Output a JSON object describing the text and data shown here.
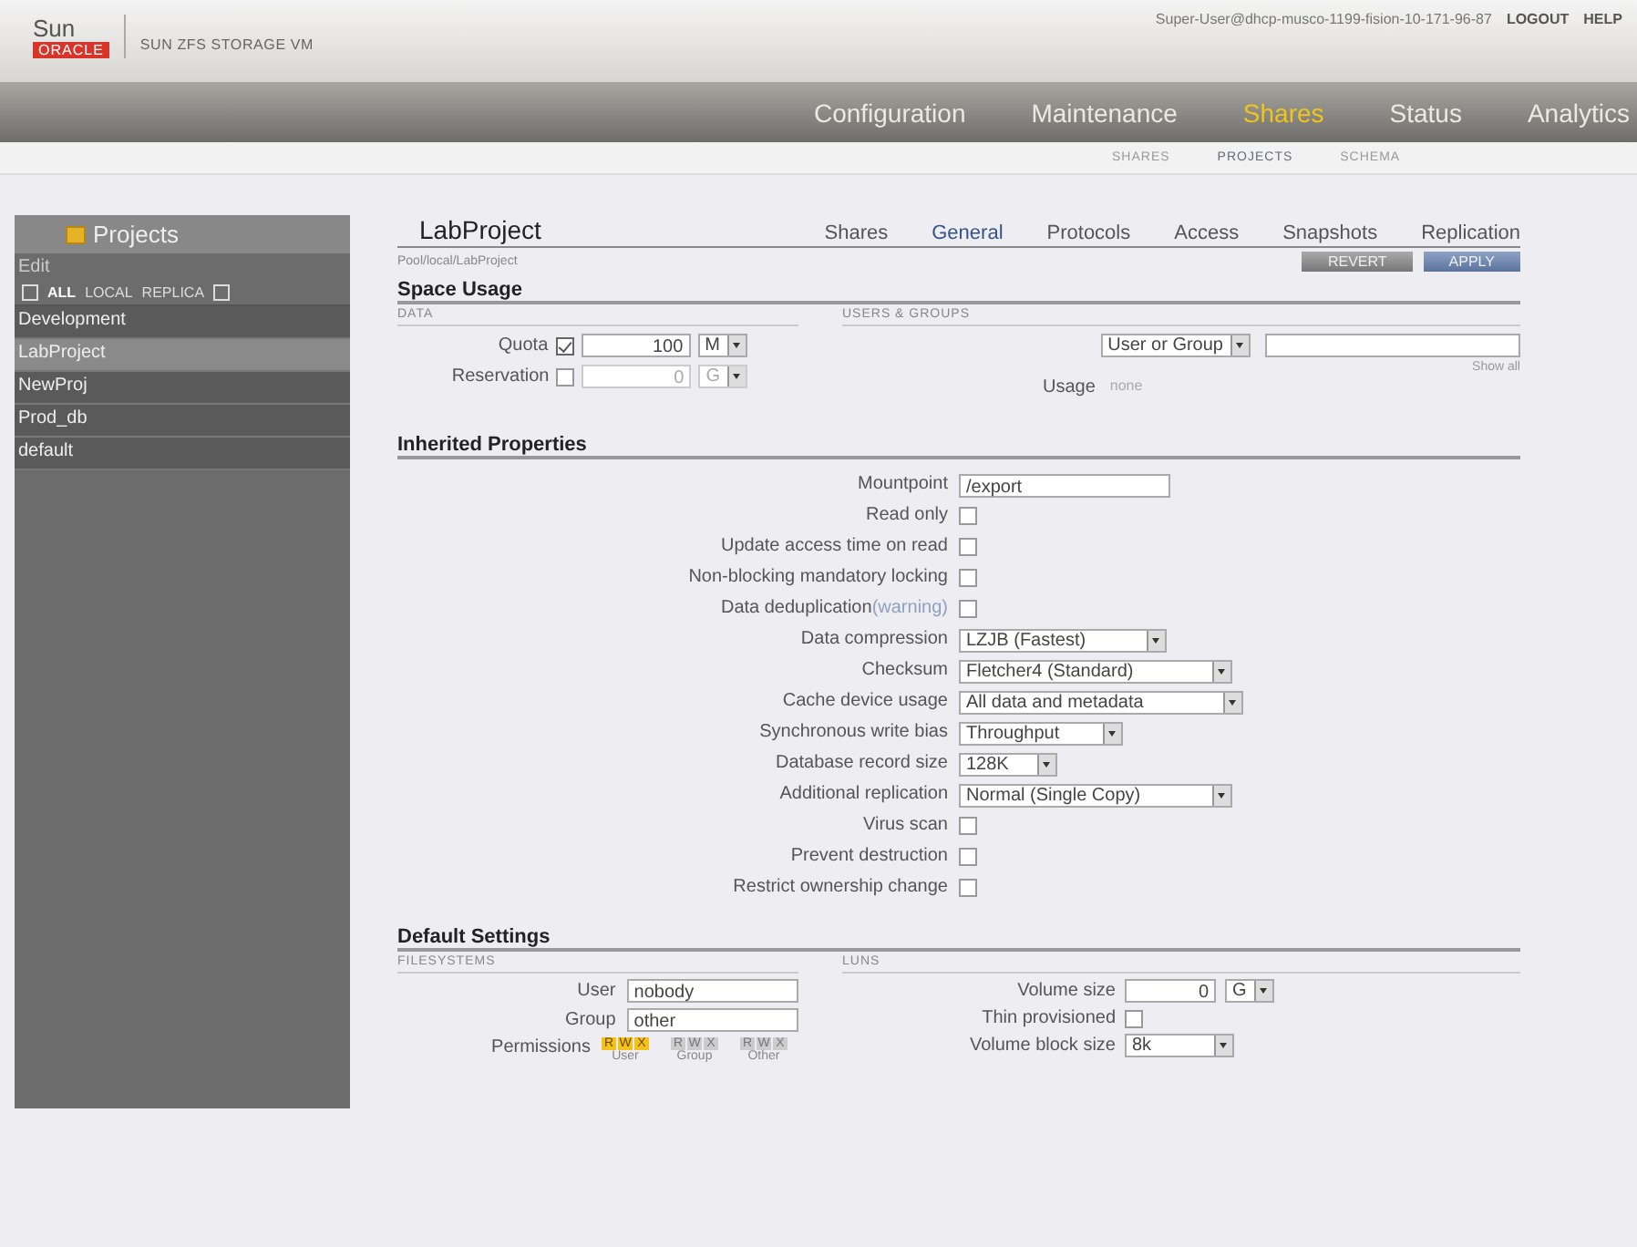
{
  "header": {
    "brand_top": "Sun",
    "brand_bottom": "ORACLE",
    "product": "SUN ZFS STORAGE VM",
    "user": "Super-User@dhcp-musco-1199-fision-10-171-96-87",
    "links": [
      "LOGOUT",
      "HELP"
    ]
  },
  "nav": {
    "tabs": [
      {
        "label": "Configuration",
        "selected": false
      },
      {
        "label": "Maintenance",
        "selected": false
      },
      {
        "label": "Shares",
        "selected": true
      },
      {
        "label": "Status",
        "selected": false
      },
      {
        "label": "Analytics",
        "selected": false
      }
    ],
    "subtabs": [
      {
        "label": "SHARES",
        "selected": false
      },
      {
        "label": "PROJECTS",
        "selected": true
      },
      {
        "label": "SCHEMA",
        "selected": false
      }
    ]
  },
  "sidebar": {
    "title": "Projects",
    "action": "Edit",
    "filters": [
      {
        "label": "ALL",
        "selected": true
      },
      {
        "label": "LOCAL",
        "selected": false
      },
      {
        "label": "REPLICA",
        "selected": false
      }
    ],
    "items": [
      {
        "label": "Development",
        "selected": false
      },
      {
        "label": "LabProject",
        "selected": true
      },
      {
        "label": "NewProj",
        "selected": false
      },
      {
        "label": "Prod_db",
        "selected": false
      },
      {
        "label": "default",
        "selected": false
      }
    ]
  },
  "project": {
    "title": "LabProject",
    "path": "Pool/local/LabProject",
    "tabs": [
      {
        "label": "Shares",
        "selected": false
      },
      {
        "label": "General",
        "selected": true
      },
      {
        "label": "Protocols",
        "selected": false
      },
      {
        "label": "Access",
        "selected": false
      },
      {
        "label": "Snapshots",
        "selected": false
      },
      {
        "label": "Replication",
        "selected": false
      }
    ],
    "buttons": [
      {
        "label": "REVERT",
        "kind": "revert"
      },
      {
        "label": "APPLY",
        "kind": "apply"
      }
    ]
  },
  "space_usage": {
    "title": "Space Usage",
    "data": {
      "heading": "DATA",
      "rows": [
        {
          "label": "Quota",
          "checked": true,
          "value": "100",
          "unit": "M",
          "disabled": false
        },
        {
          "label": "Reservation",
          "checked": false,
          "value": "0",
          "unit": "G",
          "disabled": true
        }
      ]
    },
    "users_groups": {
      "heading": "USERS & GROUPS",
      "select": "User or Group",
      "link": "Show all",
      "usage_label": "Usage",
      "usage_value": "none"
    }
  },
  "inherited": {
    "title": "Inherited Properties",
    "rows": [
      {
        "label": "Mountpoint",
        "kind": "text",
        "value": "/export"
      },
      {
        "label": "Read only",
        "kind": "checkbox",
        "checked": false
      },
      {
        "label": "Update access time on read",
        "kind": "checkbox",
        "checked": false
      },
      {
        "label": "Non-blocking mandatory locking",
        "kind": "checkbox",
        "checked": false
      },
      {
        "label": "Data deduplication",
        "note": "(warning)",
        "kind": "checkbox",
        "checked": false
      },
      {
        "label": "Data compression",
        "kind": "select",
        "value": "LZJB (Fastest)"
      },
      {
        "label": "Checksum",
        "kind": "select",
        "value": "Fletcher4 (Standard)"
      },
      {
        "label": "Cache device usage",
        "kind": "select",
        "value": "All data and metadata"
      },
      {
        "label": "Synchronous write bias",
        "kind": "select",
        "value": "Throughput"
      },
      {
        "label": "Database record size",
        "kind": "select",
        "value": "128K"
      },
      {
        "label": "Additional replication",
        "kind": "select",
        "value": "Normal (Single Copy)"
      },
      {
        "label": "Virus scan",
        "kind": "checkbox",
        "checked": false
      },
      {
        "label": "Prevent destruction",
        "kind": "checkbox",
        "checked": false
      },
      {
        "label": "Restrict ownership change",
        "kind": "checkbox",
        "checked": false
      }
    ]
  },
  "defaults": {
    "title": "Default Settings",
    "filesystems": {
      "heading": "FILESYSTEMS",
      "user_label": "User",
      "user": "nobody",
      "group_label": "Group",
      "group": "other",
      "permissions_label": "Permissions",
      "permissions": [
        {
          "name": "User",
          "bits": [
            {
              "label": "R",
              "on": true
            },
            {
              "label": "W",
              "on": true
            },
            {
              "label": "X",
              "on": true
            }
          ]
        },
        {
          "name": "Group",
          "bits": [
            {
              "label": "R",
              "on": false
            },
            {
              "label": "W",
              "on": false
            },
            {
              "label": "X",
              "on": false
            }
          ]
        },
        {
          "name": "Other",
          "bits": [
            {
              "label": "R",
              "on": false
            },
            {
              "label": "W",
              "on": false
            },
            {
              "label": "X",
              "on": false
            }
          ]
        }
      ]
    },
    "luns": {
      "heading": "LUNS",
      "size_label": "Volume size",
      "size": "0",
      "size_unit": "G",
      "thin_label": "Thin provisioned",
      "thin": false,
      "block_label": "Volume block size",
      "block": "8k"
    }
  }
}
